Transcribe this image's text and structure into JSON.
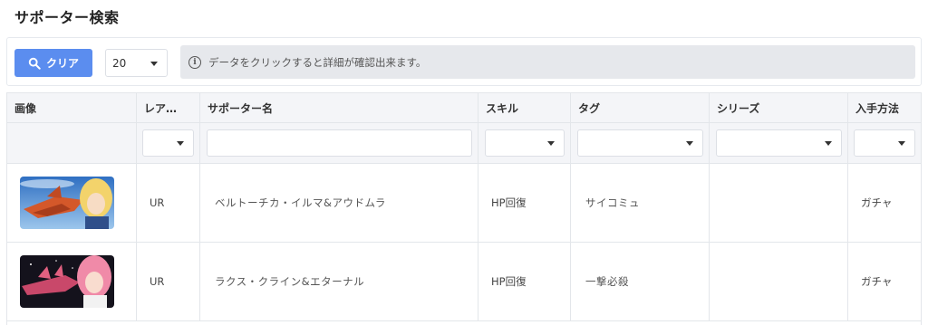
{
  "page": {
    "title": "サポーター検索"
  },
  "toolbar": {
    "clear_label": "クリア",
    "page_size": "20",
    "info_text": "データをクリックすると詳細が確認出来ます。"
  },
  "table": {
    "columns": [
      "画像",
      "レア…",
      "サポーター名",
      "スキル",
      "タグ",
      "シリーズ",
      "入手方法"
    ],
    "rows": [
      {
        "rarity": "UR",
        "name": "ベルトーチカ・イルマ&アウドムラ",
        "skill": "HP回復",
        "tag": "サイコミュ",
        "series": "",
        "acquisition": "ガチャ"
      },
      {
        "rarity": "UR",
        "name": "ラクス・クライン&エターナル",
        "skill": "HP回復",
        "tag": "一撃必殺",
        "series": "",
        "acquisition": "ガチャ"
      }
    ]
  }
}
